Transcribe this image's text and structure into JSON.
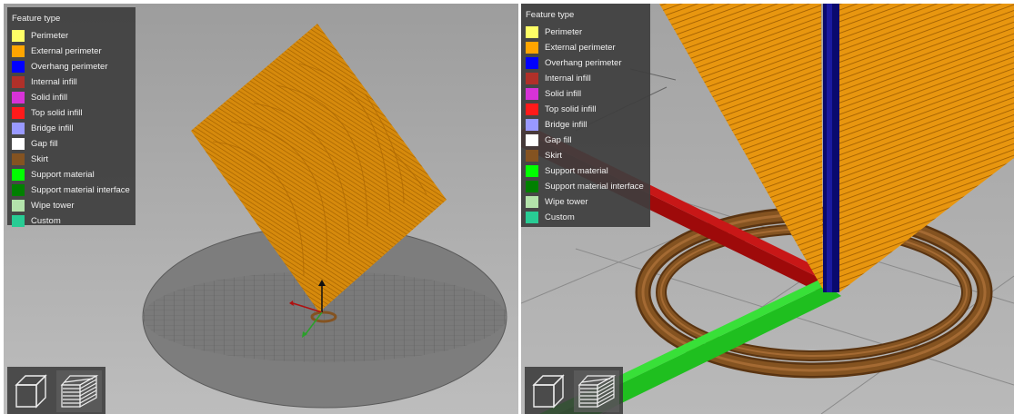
{
  "legend_title": "Feature type",
  "legend_items": [
    {
      "label": "Perimeter",
      "color": "#FFFF66"
    },
    {
      "label": "External perimeter",
      "color": "#FFA500"
    },
    {
      "label": "Overhang perimeter",
      "color": "#0000FF"
    },
    {
      "label": "Internal infill",
      "color": "#B03029"
    },
    {
      "label": "Solid infill",
      "color": "#D732D7"
    },
    {
      "label": "Top solid infill",
      "color": "#FF1A1A"
    },
    {
      "label": "Bridge infill",
      "color": "#9999FF"
    },
    {
      "label": "Gap fill",
      "color": "#FFFFFF"
    },
    {
      "label": "Skirt",
      "color": "#845321"
    },
    {
      "label": "Support material",
      "color": "#00FF00"
    },
    {
      "label": "Support material interface",
      "color": "#008000"
    },
    {
      "label": "Wipe tower",
      "color": "#B3E3AB"
    },
    {
      "label": "Custom",
      "color": "#28CC94"
    }
  ],
  "view_buttons": [
    {
      "name": "3d-view-button",
      "icon": "cube-icon"
    },
    {
      "name": "preview-button",
      "icon": "layers-icon"
    }
  ]
}
